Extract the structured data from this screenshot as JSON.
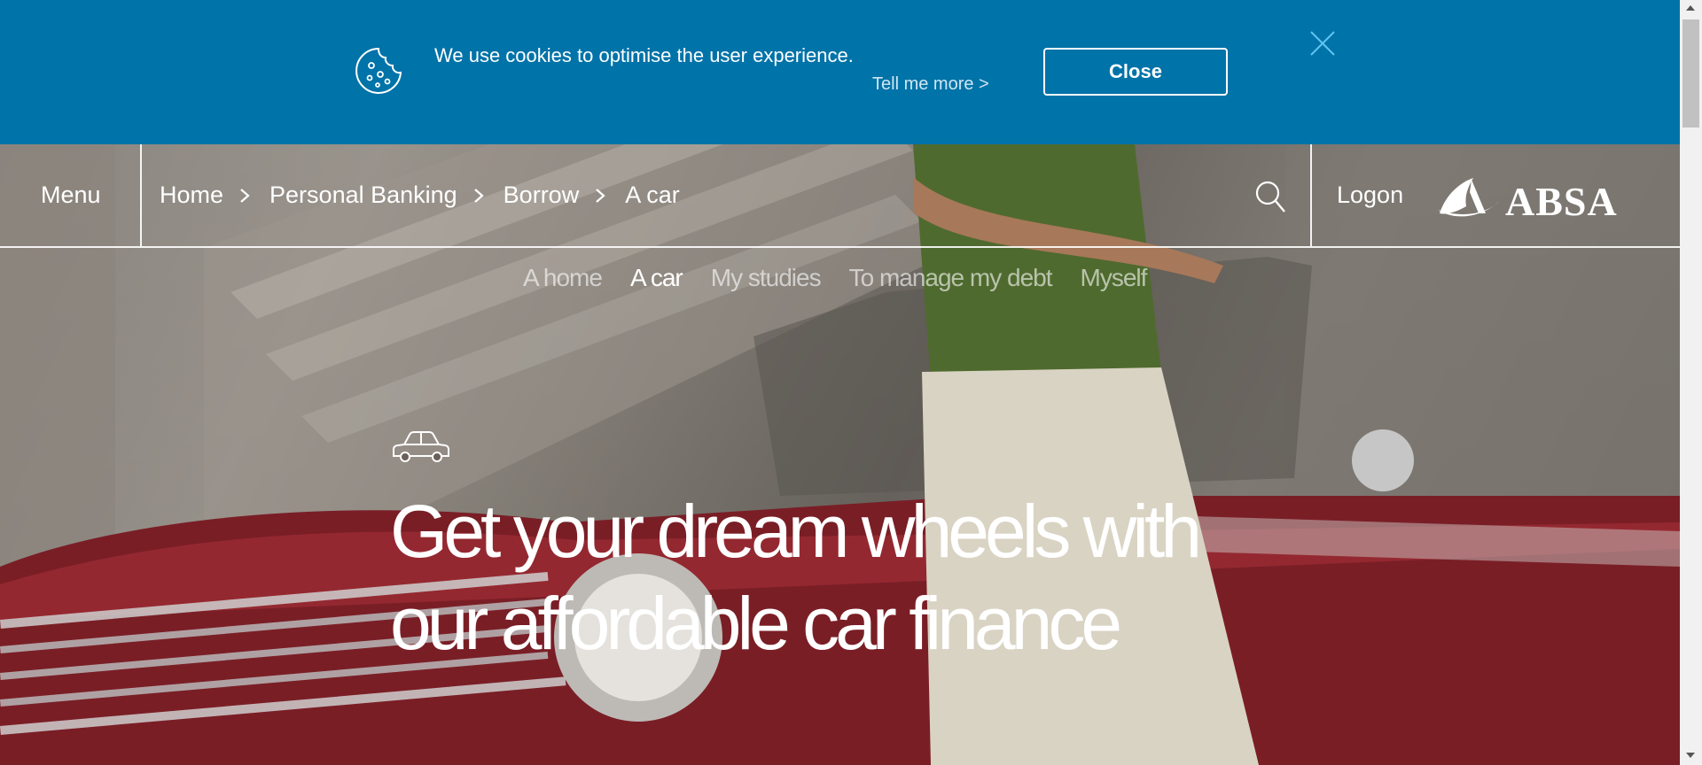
{
  "cookie_banner": {
    "message": "We use cookies to optimise the user experience.",
    "more_link": "Tell me more >",
    "close_label": "Close",
    "background": "#0073a8"
  },
  "header": {
    "menu_label": "Menu",
    "breadcrumb": [
      "Home",
      "Personal Banking",
      "Borrow",
      "A car"
    ],
    "logon_label": "Logon",
    "brand": "ABSA"
  },
  "subnav": {
    "items": [
      "A home",
      "A car",
      "My studies",
      "To manage my debt",
      "Myself"
    ],
    "active": "A car"
  },
  "hero": {
    "headline_line1": "Get your dream wheels with",
    "headline_line2": "our affordable car finance",
    "icon": "car-icon"
  },
  "icons": {
    "cookie": "cookie-icon",
    "close": "close-icon",
    "search": "search-icon",
    "chevron": "chevron-right-icon"
  }
}
